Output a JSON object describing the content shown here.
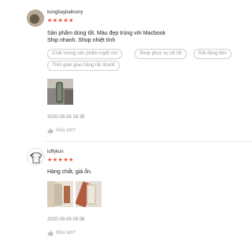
{
  "reviews": [
    {
      "username": "bongbayballoony",
      "stars": "★★★★★",
      "comment_lines": [
        "Sản phẩm dùng tốt. Màu đẹp trùng với Macbook",
        "Ship nhanh. Shop nhiệt tình"
      ],
      "tags": [
        "Chất lượng sản phẩm tuyệt vời",
        "Shop phục vụ rất tốt",
        "Rất đáng tiền",
        "Thời gian giao hàng rất nhanh"
      ],
      "timestamp": "2020-09-28 16:39",
      "helpful_label": "Hữu ích?",
      "rating": 5
    },
    {
      "username": "luffykun",
      "stars": "★★★★★",
      "comment_lines": [
        "Hàng chất, giá ổn."
      ],
      "tags": [],
      "timestamp": "2020-09-09 09:38",
      "helpful_label": "Hữu ích?",
      "rating": 5
    }
  ],
  "colors": {
    "star": "#ee4d2d",
    "tag_border": "#cfcfcf",
    "muted_text": "#999999"
  },
  "icons": {
    "helpful": "thumbs-up-icon"
  }
}
